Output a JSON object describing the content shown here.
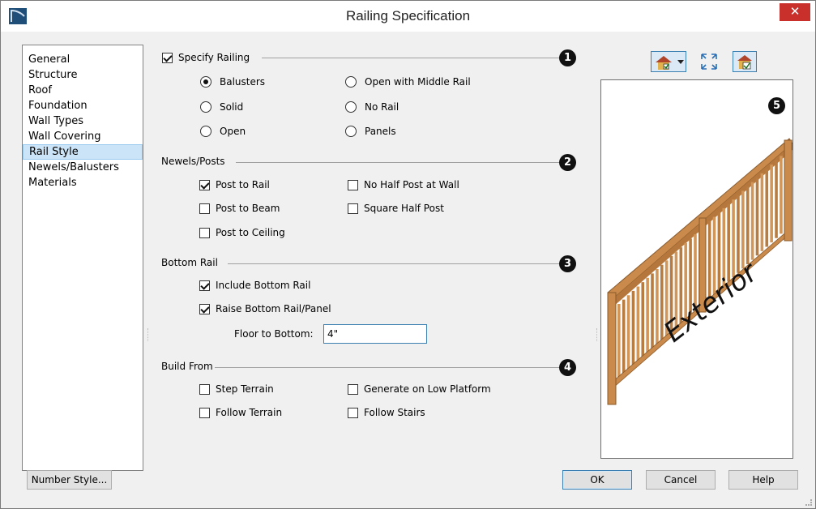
{
  "window": {
    "title": "Railing Specification",
    "close_label": "✕",
    "accent_color": "#c9302c"
  },
  "nav": {
    "items": [
      "General",
      "Structure",
      "Roof",
      "Foundation",
      "Wall Types",
      "Wall Covering",
      "Rail Style",
      "Newels/Balusters",
      "Materials"
    ],
    "selected": "Rail Style"
  },
  "railing": {
    "specify_label": "Specify Railing",
    "specify_checked": true,
    "balusters": "Balusters",
    "solid": "Solid",
    "open": "Open",
    "open_middle": "Open with Middle Rail",
    "no_rail": "No Rail",
    "panels": "Panels",
    "selected": "Balusters"
  },
  "newels": {
    "title": "Newels/Posts",
    "post_to_rail": "Post to Rail",
    "post_to_beam": "Post to Beam",
    "post_to_ceiling": "Post to Ceiling",
    "no_half_post": "No Half Post at Wall",
    "square_half_post": "Square Half Post"
  },
  "bottom_rail": {
    "title": "Bottom Rail",
    "include": "Include Bottom Rail",
    "raise": "Raise Bottom Rail/Panel",
    "floor_to_bottom_label": "Floor to Bottom:",
    "floor_to_bottom_value": "4\""
  },
  "build_from": {
    "title": "Build From",
    "step_terrain": "Step Terrain",
    "follow_terrain": "Follow Terrain",
    "low_platform": "Generate on Low Platform",
    "follow_stairs": "Follow Stairs"
  },
  "badges": [
    "1",
    "2",
    "3",
    "4",
    "5"
  ],
  "preview": {
    "label": "Exterior",
    "rail_color": "#c98a4b",
    "icons": [
      "view-mode-icon",
      "chevron-down-icon",
      "fit-view-icon",
      "lock-view-icon"
    ]
  },
  "buttons": {
    "number_style": "Number Style...",
    "ok": "OK",
    "cancel": "Cancel",
    "help": "Help"
  }
}
